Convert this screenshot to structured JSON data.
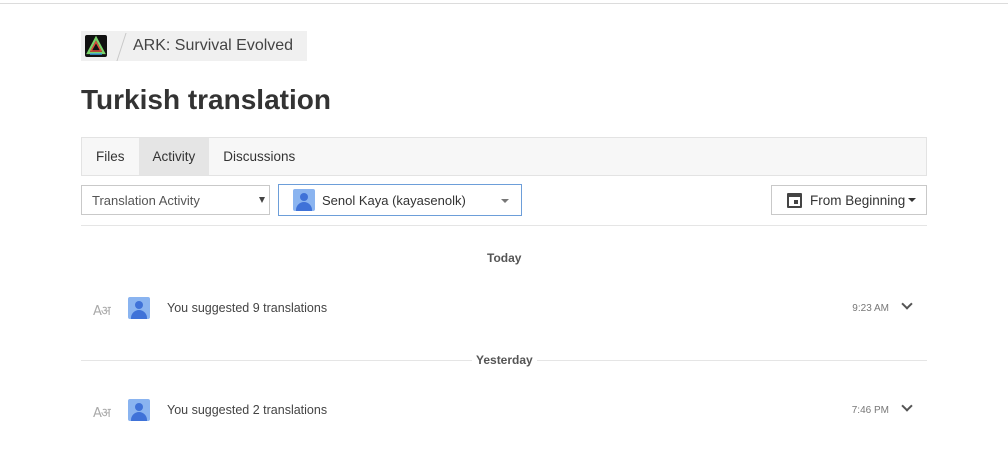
{
  "project": {
    "name": "ARK: Survival Evolved",
    "logo_icon": "ark-logo-icon"
  },
  "page": {
    "title": "Turkish translation"
  },
  "tabs": [
    {
      "label": "Files",
      "active": false
    },
    {
      "label": "Activity",
      "active": true
    },
    {
      "label": "Discussions",
      "active": false
    }
  ],
  "filters": {
    "activity_type": "Translation Activity",
    "user": "Senol Kaya (kayasenolk)",
    "date_range": "From Beginning"
  },
  "groups": [
    {
      "day": "Today",
      "items": [
        {
          "icon": "translate-icon",
          "text": "You suggested 9 translations",
          "time": "9:23 AM"
        }
      ]
    },
    {
      "day": "Yesterday",
      "items": [
        {
          "icon": "translate-icon",
          "text": "You suggested 2 translations",
          "time": "7:46 PM"
        }
      ]
    }
  ],
  "colors": {
    "accent_border": "#6d9ed9",
    "avatar_bg": "#8ab4f0",
    "avatar_fg": "#3f72d8"
  }
}
